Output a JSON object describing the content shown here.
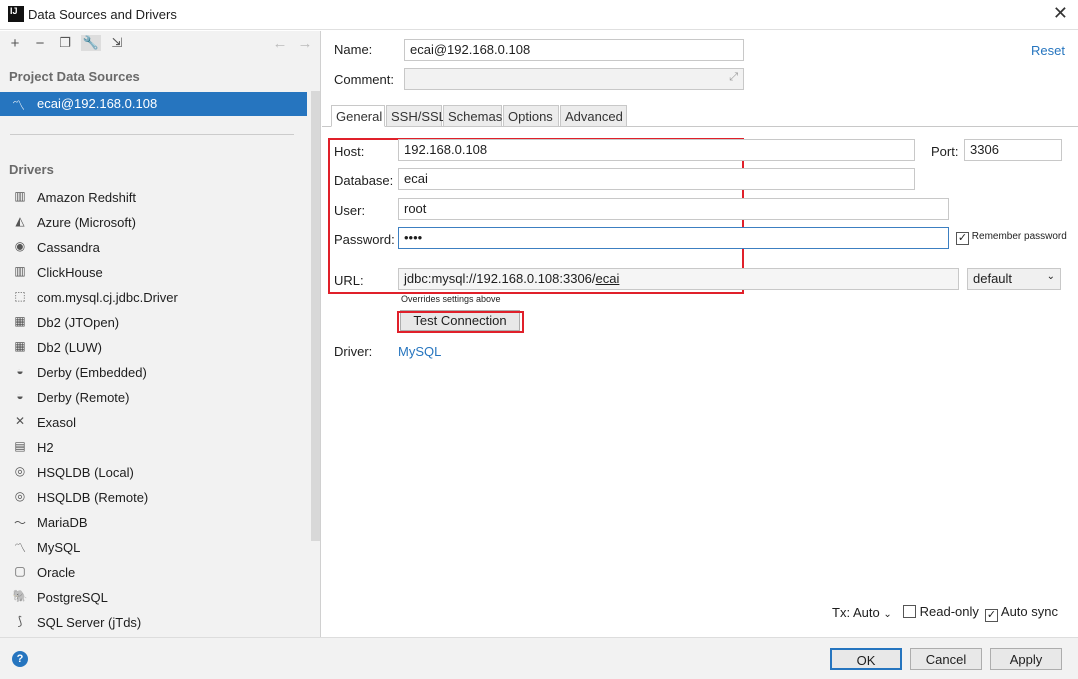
{
  "window": {
    "title": "Data Sources and Drivers",
    "close_icon": "close-icon"
  },
  "sidebar": {
    "toolbar": [
      "add-icon",
      "remove-icon",
      "duplicate-icon",
      "wrench-icon",
      "import-icon",
      "back-icon",
      "forward-icon"
    ],
    "project_header": "Project Data Sources",
    "selected_source": "ecai@192.168.0.108",
    "drivers_header": "Drivers",
    "drivers": [
      {
        "label": "Amazon Redshift",
        "icon": "▥"
      },
      {
        "label": "Azure (Microsoft)",
        "icon": "◭"
      },
      {
        "label": "Cassandra",
        "icon": "◉"
      },
      {
        "label": "ClickHouse",
        "icon": "▥"
      },
      {
        "label": "com.mysql.cj.jdbc.Driver",
        "icon": "⬚"
      },
      {
        "label": "Db2 (JTOpen)",
        "icon": "▦"
      },
      {
        "label": "Db2 (LUW)",
        "icon": "▦"
      },
      {
        "label": "Derby (Embedded)",
        "icon": "◒"
      },
      {
        "label": "Derby (Remote)",
        "icon": "◒"
      },
      {
        "label": "Exasol",
        "icon": "✕"
      },
      {
        "label": "H2",
        "icon": "▤"
      },
      {
        "label": "HSQLDB (Local)",
        "icon": "◎"
      },
      {
        "label": "HSQLDB (Remote)",
        "icon": "◎"
      },
      {
        "label": "MariaDB",
        "icon": "〜"
      },
      {
        "label": "MySQL",
        "icon": "〽"
      },
      {
        "label": "Oracle",
        "icon": "▢"
      },
      {
        "label": "PostgreSQL",
        "icon": "🐘"
      },
      {
        "label": "SQL Server (jTds)",
        "icon": "⟆"
      }
    ]
  },
  "form": {
    "name_label": "Name:",
    "name_value": "ecai@192.168.0.108",
    "reset": "Reset",
    "comment_label": "Comment:",
    "tabs": [
      "General",
      "SSH/SSL",
      "Schemas",
      "Options",
      "Advanced"
    ],
    "host_label": "Host:",
    "host": "192.168.0.108",
    "port_label": "Port:",
    "port": "3306",
    "database_label": "Database:",
    "database": "ecai",
    "user_label": "User:",
    "user": "root",
    "password_label": "Password:",
    "password": "••••",
    "remember_password": "Remember password",
    "remember_checked": true,
    "url_label": "URL:",
    "url_prefix": "jdbc:mysql://192.168.0.108:3306/",
    "url_db": "ecai",
    "url_mode": "default",
    "url_hint": "Overrides settings above",
    "test_connection": "Test Connection",
    "driver_label": "Driver:",
    "driver": "MySQL",
    "tx": "Tx: Auto",
    "readonly": "Read-only",
    "autosync": "Auto sync"
  },
  "footer": {
    "help": "?",
    "ok": "OK",
    "cancel": "Cancel",
    "apply": "Apply"
  },
  "colors": {
    "accent": "#2675bf",
    "highlight": "#e0202a"
  }
}
